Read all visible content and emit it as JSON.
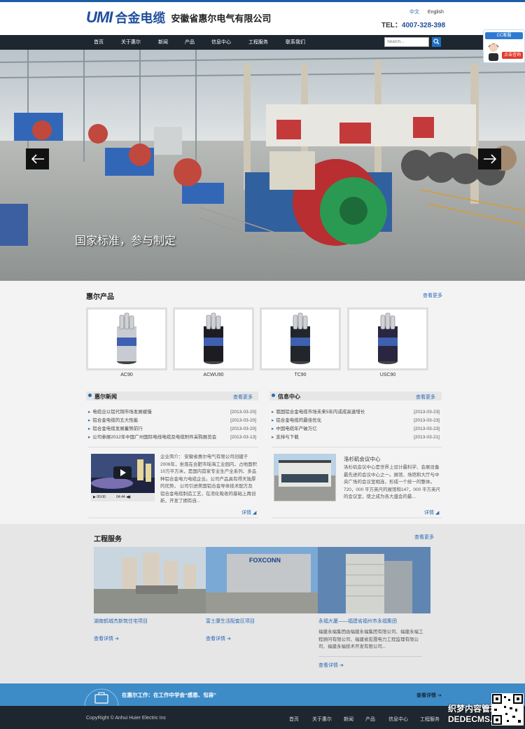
{
  "header": {
    "logo_umi": "UMI",
    "logo_cn": "合金电缆",
    "logo_company": "安徽省惠尔电气有限公司",
    "lang_zh": "中文",
    "lang_en": "English",
    "phone_label": "TEL：",
    "phone": "4007-328-398"
  },
  "nav": {
    "items": [
      "首页",
      "关于惠尔",
      "新闻",
      "产品",
      "信息中心",
      "工程服务",
      "联系我们"
    ],
    "search_placeholder": "Search...",
    "search_icon": "search-icon"
  },
  "cc": {
    "title": "CC客服",
    "button": "点击咨询"
  },
  "banner": {
    "caption": "国家标准，参与制定",
    "prev": "prev-arrow-icon",
    "next": "next-arrow-icon"
  },
  "products": {
    "title": "惠尔产品",
    "more": "查看更多",
    "items": [
      {
        "name": "AC90",
        "sheath": "#c8ccd2"
      },
      {
        "name": "ACWU90",
        "sheath": "#1c1c22"
      },
      {
        "name": "TC90",
        "sheath": "#22252c"
      },
      {
        "name": "USC90",
        "sheath": "#2a2540"
      }
    ]
  },
  "news": {
    "title": "惠尔新闻",
    "more": "查看更多",
    "rows": [
      {
        "text": "电缆业以铝代铜市场发展缓慢",
        "date": "[2013-03-20]"
      },
      {
        "text": "铝合金电缆的五大性能",
        "date": "[2013-03-20]"
      },
      {
        "text": "铝合金电缆发展蓄势前行",
        "date": "[2013-03-20]"
      },
      {
        "text": "公司参展2012年中国广州国际电线电缆及电缆附件采购展览会",
        "date": "[2013-03-13]"
      }
    ],
    "intro": "企业简介：      安徽省惠尔电气有限公司创建于2006年，坐落在合肥市瑶海工业园内，占地面积10万平方米，是国内首家专业生产全系列、多品种铝合金电力电缆企业。公司产品具有得天独厚的优势，      公司引进美国铝合金导体技术配方及铝合金电缆制造工艺，在消化吸收的基础上再创新，开发了拥有自...",
    "player_time": "00:00",
    "player_duration": "04:44",
    "detail": "详情"
  },
  "info": {
    "title": "信息中心",
    "more": "查看更多",
    "rows": [
      {
        "text": "我国铝合金电缆市场未来5年内或成高速增长",
        "date": "[2013-03-23]"
      },
      {
        "text": "铝合金电缆的最佳优化",
        "date": "[2013-03-23]"
      },
      {
        "text": "中国电缆年产破万亿",
        "date": "[2013-03-23]"
      },
      {
        "text": "支持与下载",
        "date": "[2013-03-21]"
      }
    ],
    "feature_title": "洛杉矶会议中心",
    "feature_text": "洛杉矶会议中心是世界上设计最科学、会展设备最先进的会议中心之一。展馆、场馆和大厅与中央广场的会议室相连，形成一个统一的整体。720，000 平方英尺的展馆和147，000 平方英尺的会议室，使之成为各大盛会的最...",
    "detail": "详情"
  },
  "projects": {
    "title": "工程服务",
    "more": "查看更多",
    "items": [
      {
        "title": "湖南鹤城杰新筑住宅项目",
        "link": "查看详情"
      },
      {
        "title": "富士康生活配套区项目",
        "link": "查看详情"
      },
      {
        "title": "永福大厦——福建省福州市永福集团",
        "link": "查看详情",
        "desc": "福建永福集团由福建永福集团有限公司、福建永福工程顾问有限公司、福建省宏晟电力工程监理有限公司、福建永福技术开发有限公司..."
      }
    ],
    "image_sign": "FOXCONN"
  },
  "slogan": {
    "text": "在惠尔工作：在工作中学会“感恩、包容”",
    "link": "查看详情"
  },
  "footer": {
    "copyright": "CopyRight © Anhui Huier Electric Inc",
    "links": [
      "首页",
      "关于惠尔",
      "新闻",
      "产品",
      "信息中心",
      "工程服务"
    ]
  },
  "watermark": "织梦内容管理系统 DEDECMS.COM",
  "colors": {
    "brand": "#1f4f9c",
    "nav_bg": "#1e2630",
    "link": "#2a6ab5",
    "slogan_bg": "#3d8cc8"
  }
}
